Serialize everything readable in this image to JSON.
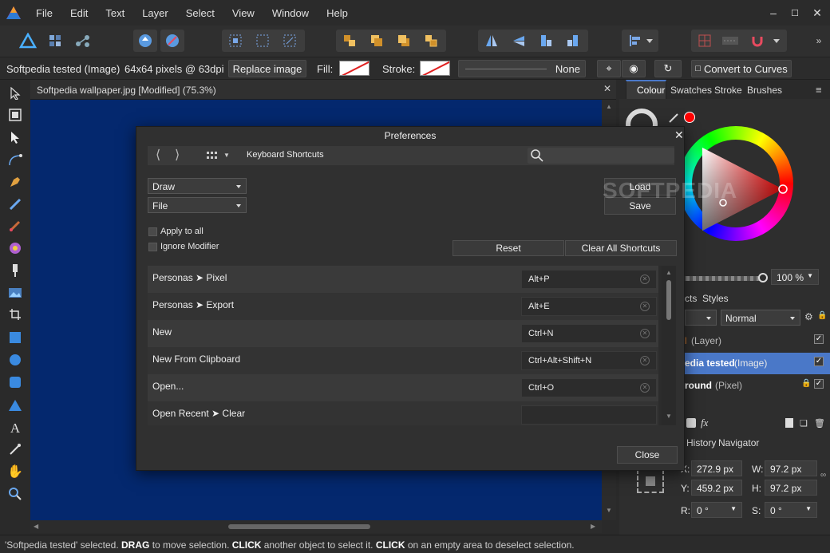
{
  "menu": [
    "File",
    "Edit",
    "Text",
    "Layer",
    "Select",
    "View",
    "Window",
    "Help"
  ],
  "context": {
    "layer_name": "Softpedia tested (Image)",
    "size_info": "64x64 pixels @ 63dpi",
    "replace_btn": "Replace image",
    "fill_label": "Fill:",
    "stroke_label": "Stroke:",
    "stroke_value": "None",
    "convert_btn": "Convert to Curves"
  },
  "document": {
    "tab_title": "Softpedia wallpaper.jpg [Modified] (75.3%)",
    "canvas_color": "#04286e"
  },
  "right_panel": {
    "tabs": [
      "Colour",
      "Swatches",
      "Stroke",
      "Brushes"
    ],
    "opacity": "100 %",
    "layer_tabs": [
      "cts",
      "Styles"
    ],
    "blend_mode": "Normal",
    "layers": [
      {
        "name": "l",
        "kind": "(Layer)",
        "selected": false
      },
      {
        "name": "edia tested",
        "kind": "(Image)",
        "selected": true
      },
      {
        "name": "round",
        "kind": "(Pixel)",
        "selected": false
      }
    ],
    "bottom_tabs": [
      "History",
      "Navigator"
    ],
    "transform": {
      "x_label": "X:",
      "x": "272.9 px",
      "y_label": "Y:",
      "y": "459.2 px",
      "w_label": "W:",
      "w": "97.2 px",
      "h_label": "H:",
      "h": "97.2 px",
      "r_label": "R:",
      "r": "0 °",
      "s_label": "S:",
      "s": "0 °"
    }
  },
  "dialog": {
    "title": "Preferences",
    "section": "Keyboard Shortcuts",
    "category1": "Draw",
    "category2": "File",
    "load": "Load",
    "save": "Save",
    "apply_all": "Apply to all",
    "ignore_modifier": "Ignore Modifier",
    "reset": "Reset",
    "clear_all": "Clear All Shortcuts",
    "close": "Close",
    "watermark": "SOFTPEDIA",
    "shortcuts": [
      {
        "name": "Personas ➤ Pixel",
        "key": "Alt+P"
      },
      {
        "name": "Personas ➤ Export",
        "key": "Alt+E"
      },
      {
        "name": "New",
        "key": "Ctrl+N"
      },
      {
        "name": "New From Clipboard",
        "key": "Ctrl+Alt+Shift+N"
      },
      {
        "name": "Open...",
        "key": "Ctrl+O"
      },
      {
        "name": "Open Recent ➤ Clear",
        "key": ""
      }
    ]
  },
  "status": {
    "q": "'Softpedia tested' selected. ",
    "k1": "DRAG",
    "t1": " to move selection. ",
    "k2": "CLICK",
    "t2": " another object to select it. ",
    "k3": "CLICK",
    "t3": " on an empty area to deselect selection."
  },
  "colors": {
    "accent": "#4a78c8",
    "fill_stroke_slash": "#e02020"
  }
}
